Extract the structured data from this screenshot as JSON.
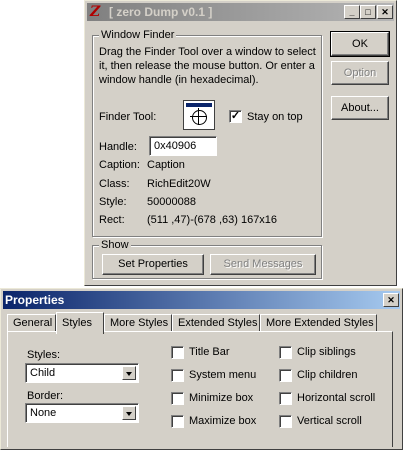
{
  "main_window": {
    "title": "[ zero Dump v0.1 ]",
    "finder_group": {
      "label": "Window Finder",
      "instructions": "Drag the Finder Tool over a window to select it, then release the mouse button.  Or enter a window handle (in hexadecimal).",
      "finder_tool_label": "Finder Tool:",
      "stay_on_top_label": "Stay on top",
      "stay_on_top_checked": true,
      "handle_label": "Handle:",
      "handle_value": "0x40906",
      "caption_label": "Caption:",
      "caption_value": "Caption",
      "class_label": "Class:",
      "class_value": "RichEdit20W",
      "style_label": "Style:",
      "style_value": "50000088",
      "rect_label": "Rect:",
      "rect_value": "(511 ,47)-(678 ,63) 167x16"
    },
    "show_group": {
      "label": "Show",
      "set_properties": "Set Properties",
      "send_messages": "Send Messages"
    },
    "buttons": {
      "ok": "OK",
      "option": "Option",
      "about": "About..."
    }
  },
  "properties_window": {
    "title": "Properties",
    "tabs": [
      "General",
      "Styles",
      "More Styles",
      "Extended Styles",
      "More Extended Styles"
    ],
    "selected_tab": "Styles",
    "styles_label": "Styles:",
    "styles_value": "Child",
    "border_label": "Border:",
    "border_value": "None",
    "checkboxes_left": [
      "Title Bar",
      "System menu",
      "Minimize box",
      "Maximize box"
    ],
    "checkboxes_right": [
      "Clip siblings",
      "Clip children",
      "Horizontal scroll",
      "Vertical scroll"
    ]
  }
}
